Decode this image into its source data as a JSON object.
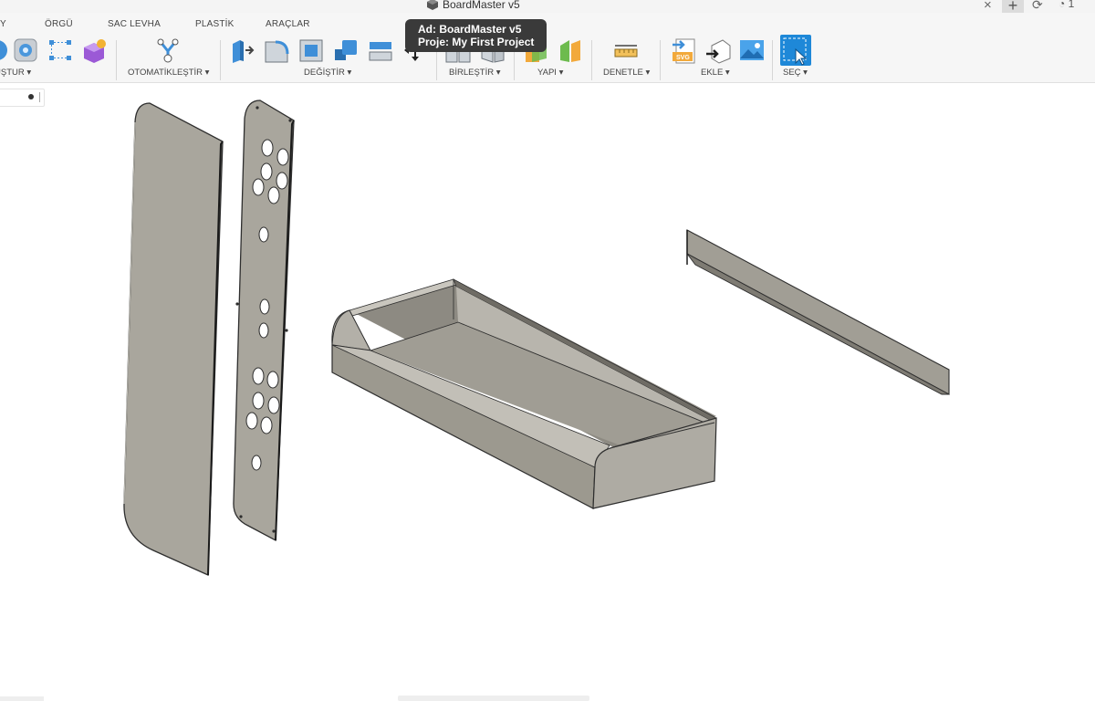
{
  "window": {
    "title": "BoardMaster v5",
    "close_symbol": "×",
    "plus_symbol": "+",
    "sync_icon": "sync-icon",
    "jobs_count": "1"
  },
  "tabs": [
    "Y",
    "ÖRGÜ",
    "SAC LEVHA",
    "PLASTİK",
    "ARAÇLAR"
  ],
  "groups": {
    "create_label": "UŞTUR ▾",
    "automate_label": "OTOMATİKLEŞTİR ▾",
    "modify_label": "DEĞİŞTİR ▾",
    "combine_label": "BİRLEŞTİR ▾",
    "construct_label": "YAPI ▾",
    "inspect_label": "DENETLE ▾",
    "insert_label": "EKLE ▾",
    "select_label": "SEÇ ▾"
  },
  "tooltip": {
    "line1": "Ad: BoardMaster v5",
    "line2": "Proje: My First Project"
  },
  "colors": {
    "accent_blue": "#2a8ad6",
    "part_fill": "#a8a59c",
    "part_dark": "#8b887f",
    "part_edge": "#2e2e2e"
  },
  "icons": [
    "sphere-icon",
    "sketch-circle-icon",
    "form-icon",
    "box-star-icon",
    "automate-icon",
    "press-pull-icon",
    "fillet-icon",
    "shell-icon",
    "scale-icon",
    "split-body-icon",
    "move-icon",
    "combine-icon",
    "plane-icon",
    "axis-icon",
    "measure-icon",
    "insert-svg-icon",
    "insert-mesh-icon",
    "insert-image-icon",
    "select-icon"
  ]
}
